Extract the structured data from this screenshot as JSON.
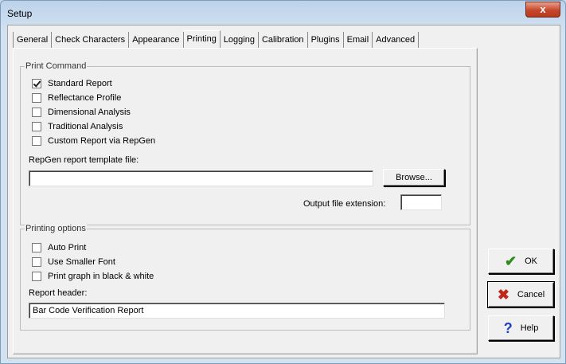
{
  "window": {
    "title": "Setup",
    "close_label": "x"
  },
  "tabs": [
    {
      "label": "General"
    },
    {
      "label": "Check Characters"
    },
    {
      "label": "Appearance"
    },
    {
      "label": "Printing"
    },
    {
      "label": "Logging"
    },
    {
      "label": "Calibration"
    },
    {
      "label": "Plugins"
    },
    {
      "label": "Email"
    },
    {
      "label": "Advanced"
    }
  ],
  "active_tab": "Printing",
  "print_command": {
    "legend": "Print Command",
    "options": [
      {
        "label": "Standard Report",
        "checked": true
      },
      {
        "label": "Reflectance Profile",
        "checked": false
      },
      {
        "label": "Dimensional Analysis",
        "checked": false
      },
      {
        "label": "Traditional Analysis",
        "checked": false
      },
      {
        "label": "Custom Report via RepGen",
        "checked": false
      }
    ],
    "template_label": "RepGen report template file:",
    "template_value": "",
    "browse_label": "Browse...",
    "ext_label": "Output file extension:",
    "ext_value": ""
  },
  "printing_options": {
    "legend": "Printing options",
    "options": [
      {
        "label": "Auto Print",
        "checked": false
      },
      {
        "label": "Use Smaller Font",
        "checked": false
      },
      {
        "label": "Print graph in black & white",
        "checked": false
      }
    ],
    "header_label": "Report header:",
    "header_value": "Bar Code Verification Report"
  },
  "buttons": {
    "ok": {
      "label": "OK",
      "icon": "checkmark-icon",
      "color": "#2f8a1f"
    },
    "cancel": {
      "label": "Cancel",
      "icon": "x-icon",
      "color": "#c0281a"
    },
    "help": {
      "label": "Help",
      "icon": "question-icon",
      "color": "#1f3fbf"
    }
  }
}
